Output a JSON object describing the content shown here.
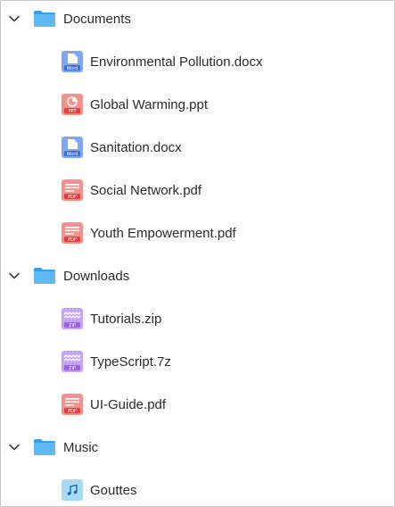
{
  "colors": {
    "folder": "#62b8f5",
    "folder_dark": "#3a9de8",
    "word": "#7fa6f0",
    "pdf": "#f5908d",
    "ppt": "#f5908d",
    "zip": "#c7a4f3",
    "audio": "#a8d9f5",
    "chevron": "#444444"
  },
  "tree": {
    "documents": {
      "label": "Documents",
      "icon": "folder-icon",
      "expanded": true,
      "files": [
        {
          "label": "Environmental Pollution.docx",
          "icon": "word-doc-icon",
          "badge": "Word"
        },
        {
          "label": "Global Warming.ppt",
          "icon": "ppt-doc-icon",
          "badge": "PPT"
        },
        {
          "label": "Sanitation.docx",
          "icon": "word-doc-icon",
          "badge": "Word"
        },
        {
          "label": "Social Network.pdf",
          "icon": "pdf-doc-icon",
          "badge": "PDF"
        },
        {
          "label": "Youth Empowerment.pdf",
          "icon": "pdf-doc-icon",
          "badge": "PDF"
        }
      ]
    },
    "downloads": {
      "label": "Downloads",
      "icon": "folder-icon",
      "expanded": true,
      "files": [
        {
          "label": "Tutorials.zip",
          "icon": "zip-doc-icon",
          "badge": "ZIP"
        },
        {
          "label": "TypeScript.7z",
          "icon": "zip-doc-icon",
          "badge": "ZIP"
        },
        {
          "label": "UI-Guide.pdf",
          "icon": "pdf-doc-icon",
          "badge": "PDF"
        }
      ]
    },
    "music": {
      "label": "Music",
      "icon": "folder-icon",
      "expanded": true,
      "files": [
        {
          "label": "Gouttes",
          "icon": "audio-file-icon"
        }
      ]
    }
  }
}
